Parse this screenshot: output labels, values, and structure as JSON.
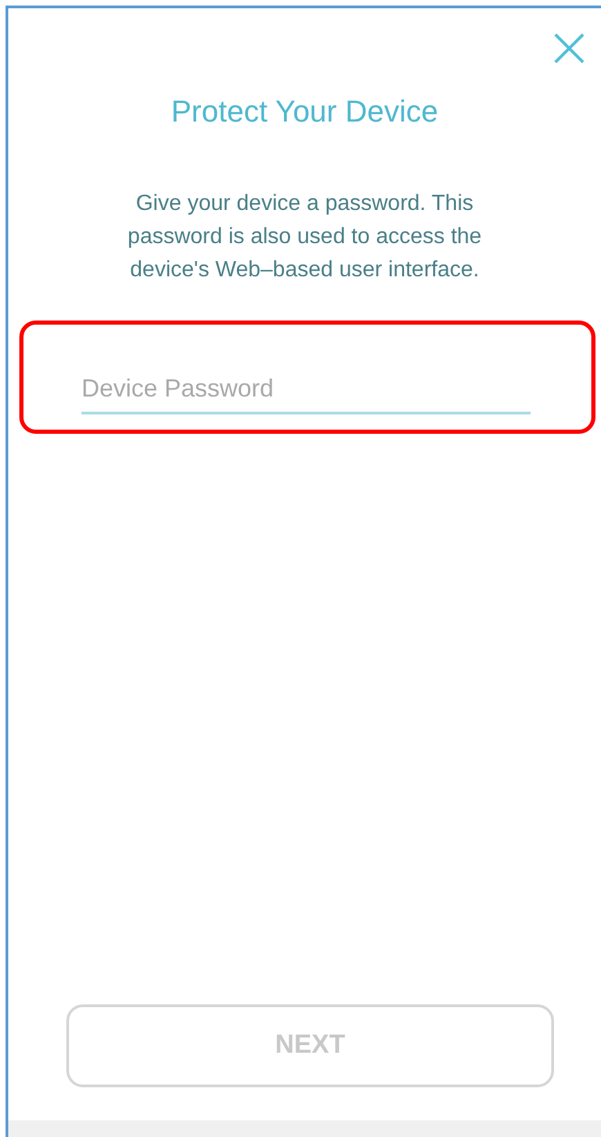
{
  "title": "Protect Your Device",
  "description": "Give your device a password. This password is also used to access the device's Web–based user interface.",
  "password_field": {
    "placeholder": "Device Password",
    "highlighted": true
  },
  "next_button": {
    "label": "NEXT",
    "disabled": true
  }
}
